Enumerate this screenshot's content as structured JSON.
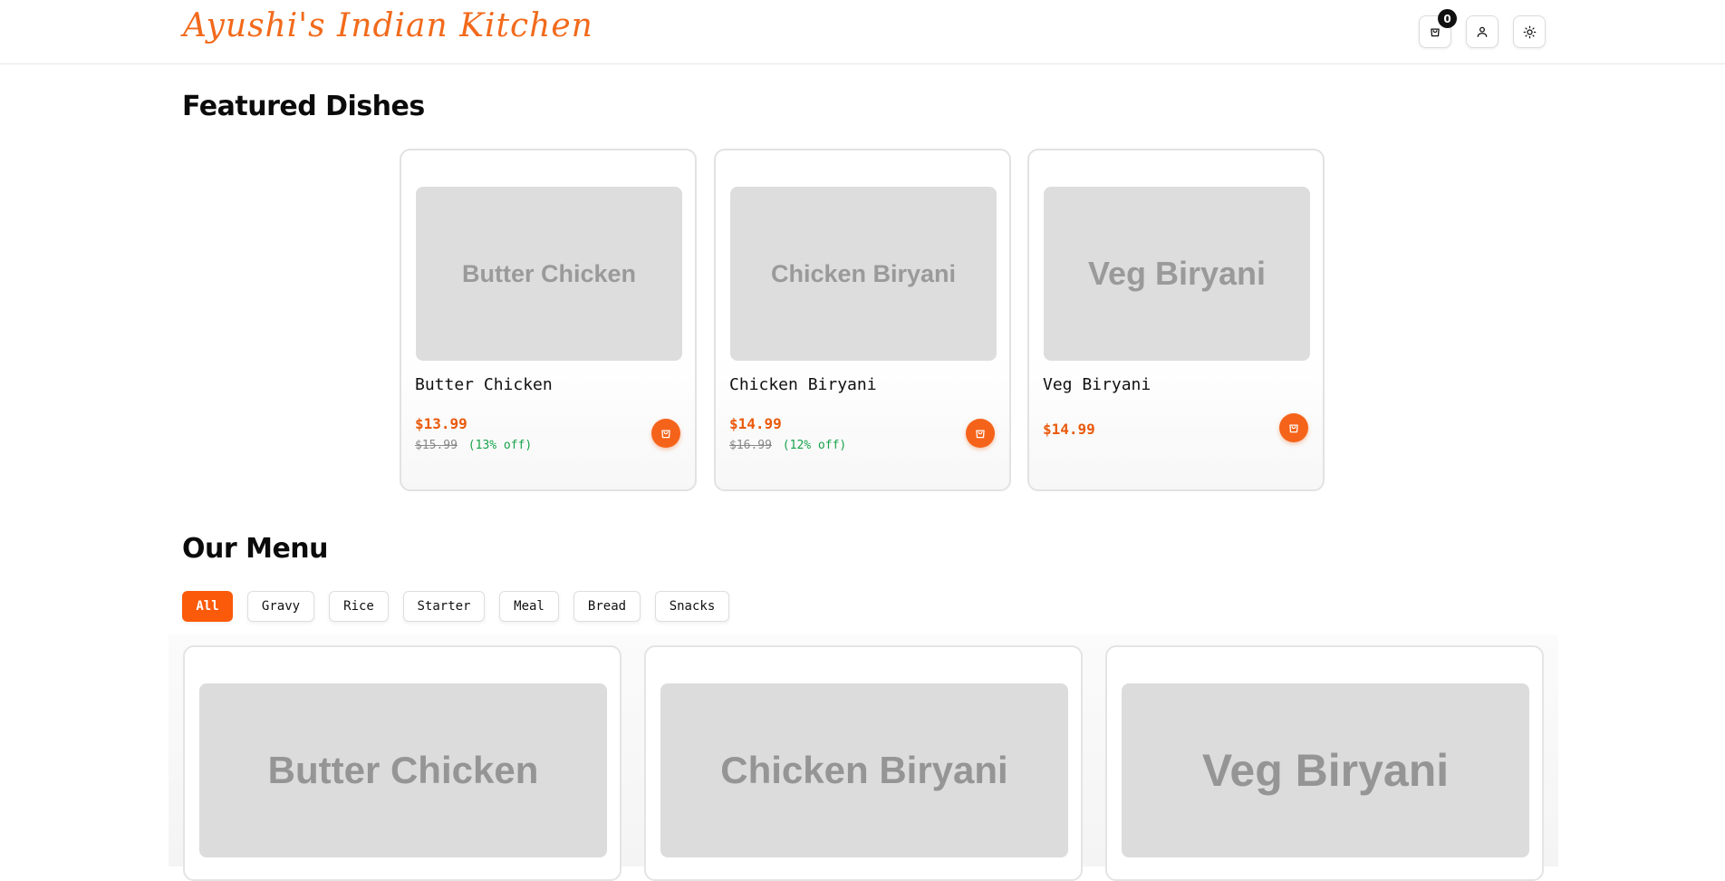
{
  "header": {
    "logo": "Ayushi's Indian Kitchen",
    "cart_count": "0",
    "icons": [
      "shopping-bag-icon",
      "user-icon",
      "sun-icon"
    ]
  },
  "featured": {
    "title": "Featured Dishes",
    "items": [
      {
        "image_text": "Butter Chicken",
        "name": "Butter Chicken",
        "price": "$13.99",
        "old_price": "$15.99",
        "discount": "(13% off)"
      },
      {
        "image_text": "Chicken Biryani",
        "name": "Chicken Biryani",
        "price": "$14.99",
        "old_price": "$16.99",
        "discount": "(12% off)"
      },
      {
        "image_text": "Veg Biryani",
        "name": "Veg Biryani",
        "price": "$14.99"
      }
    ]
  },
  "menu": {
    "title": "Our Menu",
    "filters": [
      "All",
      "Gravy",
      "Rice",
      "Starter",
      "Meal",
      "Bread",
      "Snacks"
    ],
    "active_filter": "All",
    "items": [
      {
        "image_text": "Butter Chicken"
      },
      {
        "image_text": "Chicken Biryani"
      },
      {
        "image_text": "Veg Biryani"
      }
    ]
  },
  "colors": {
    "accent": "#f26a1b",
    "price": "#ea5a0c",
    "discount": "#16a34a",
    "active_pill": "#fb5a0a"
  }
}
